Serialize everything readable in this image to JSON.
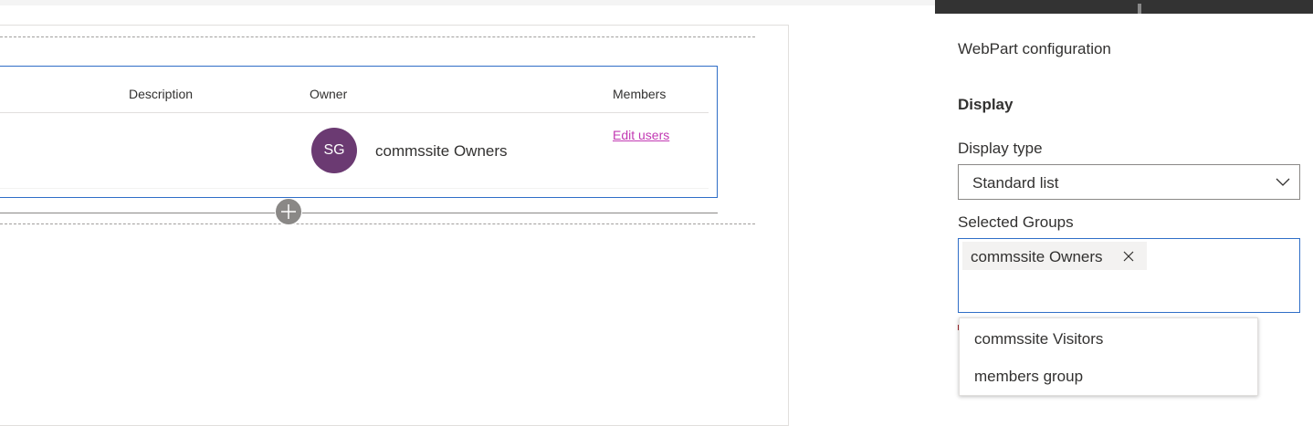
{
  "table": {
    "columns": {
      "description": "Description",
      "owner": "Owner",
      "members": "Members"
    },
    "row": {
      "owner_initials": "SG",
      "owner_name": "commssite Owners",
      "members_link": "Edit users"
    }
  },
  "panel": {
    "title": "WebPart configuration",
    "section": "Display",
    "display_type_label": "Display type",
    "display_type_value": "Standard list",
    "selected_groups_label": "Selected Groups",
    "selected_chip": "commssite Owners",
    "suggestions": [
      "commssite Visitors",
      "members group"
    ]
  },
  "colors": {
    "accent": "#2f6ec7",
    "avatar": "#6b3a72",
    "link": "#c239b3"
  }
}
